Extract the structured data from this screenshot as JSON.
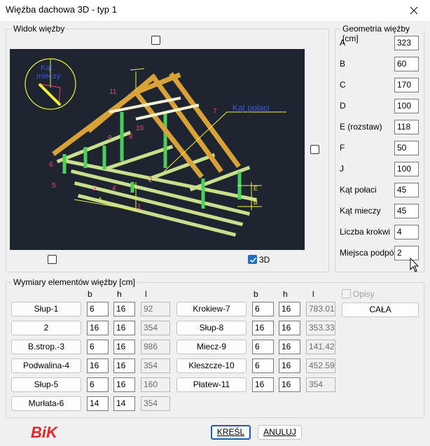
{
  "window": {
    "title": "Więźba dachowa 3D - typ 1"
  },
  "view": {
    "group_label": "Widok więźby",
    "label_3d": "3D",
    "drawing": {
      "circle_label_line1": "Kąt",
      "circle_label_line2": "mieczy",
      "roof_angle_label": "Kąt połaci",
      "numbers": [
        "11",
        "10",
        "9",
        "8",
        "7",
        "6",
        "5",
        "4",
        "3",
        "2",
        "1"
      ],
      "dim_e": "E",
      "dim_a": "A",
      "dim_b": "B"
    }
  },
  "geometry": {
    "group_label": "Geometria więźby [cm]",
    "fields": [
      {
        "label": "A",
        "value": "323"
      },
      {
        "label": "B",
        "value": "60"
      },
      {
        "label": "C",
        "value": "170"
      },
      {
        "label": "D",
        "value": "100"
      },
      {
        "label": "E (rozstaw)",
        "value": "118"
      },
      {
        "label": "F",
        "value": "50"
      },
      {
        "label": "J",
        "value": "100"
      },
      {
        "label": "Kąt połaci",
        "value": "45"
      },
      {
        "label": "Kąt mieczy",
        "value": "45"
      },
      {
        "label": "Liczba krokwi",
        "value": "4"
      },
      {
        "label": "Miejsca podpór",
        "value": "2"
      }
    ]
  },
  "dims": {
    "group_label": "Wymiary elementów więźby [cm]",
    "col_b": "b",
    "col_h": "h",
    "col_l": "l",
    "opisy_label": "Opisy",
    "cala_label": "CAŁA",
    "left": [
      {
        "name": "Słup-1",
        "b": "6",
        "h": "16",
        "l": "92"
      },
      {
        "name": "2",
        "b": "16",
        "h": "16",
        "l": "354"
      },
      {
        "name": "B.strop.-3",
        "b": "6",
        "h": "16",
        "l": "986"
      },
      {
        "name": "Podwalina-4",
        "b": "16",
        "h": "16",
        "l": "354"
      },
      {
        "name": "Słup-5",
        "b": "6",
        "h": "16",
        "l": "160"
      },
      {
        "name": "Murłata-6",
        "b": "14",
        "h": "14",
        "l": "354"
      }
    ],
    "right": [
      {
        "name": "Krokiew-7",
        "b": "6",
        "h": "16",
        "l": "783.01"
      },
      {
        "name": "Słup-8",
        "b": "16",
        "h": "16",
        "l": "353.33"
      },
      {
        "name": "Miecz-9",
        "b": "6",
        "h": "16",
        "l": "141.42"
      },
      {
        "name": "Kleszcze-10",
        "b": "6",
        "h": "16",
        "l": "452.59"
      },
      {
        "name": "Płatew-11",
        "b": "16",
        "h": "16",
        "l": "354"
      }
    ]
  },
  "footer": {
    "logo": "BiK",
    "ok_label": "KREŚL",
    "cancel_label": "ANULUJ"
  },
  "colors": {
    "viewport_bg": "#1e2530",
    "rafter": "#d9a236",
    "post": "#4ccf5a",
    "beam": "#c9df8c",
    "annot": "#ff3d7a",
    "dim": "#f0f03a",
    "blue_label": "#3b57d8"
  }
}
